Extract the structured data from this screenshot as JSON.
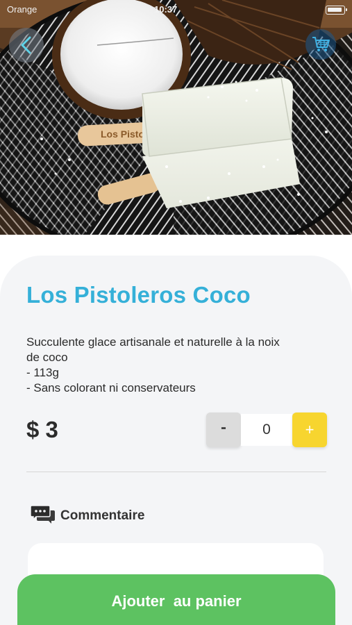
{
  "status_bar": {
    "carrier": "Orange",
    "time": "10:37"
  },
  "hero": {
    "image_description_icon": "coconut-ice-pop-photo",
    "stick_text": "Los Pistol"
  },
  "nav": {
    "back_icon": "chevron-left-icon",
    "cart_icon": "shopping-cart-icon"
  },
  "product": {
    "name": "Los Pistoleros Coco",
    "description_lines": [
      "Succulente glace artisanale et naturelle à la noix",
      "de coco",
      "- 113g",
      "- Sans colorant ni conservateurs"
    ],
    "price": "$ 3"
  },
  "quantity": {
    "minus_label": "-",
    "value": "0",
    "plus_label": "+"
  },
  "comment": {
    "label": "Commentaire",
    "icon": "chat-bubbles-icon"
  },
  "cta": {
    "label": "Ajouter  au panier"
  },
  "colors": {
    "title": "#35b0d8",
    "plus": "#f7d52f",
    "cta": "#5dc261",
    "card": "#f4f5f7"
  }
}
